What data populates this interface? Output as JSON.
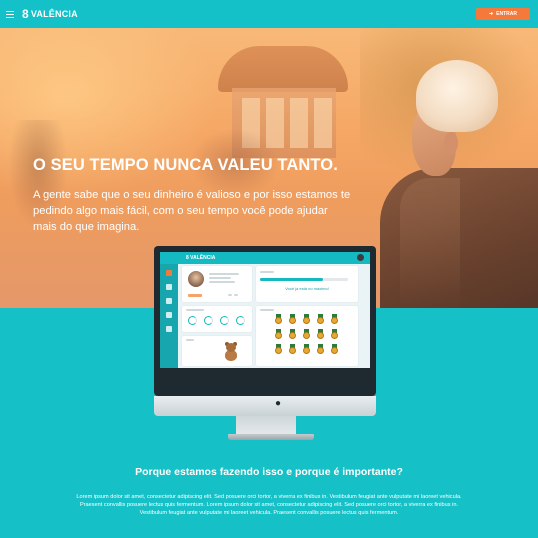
{
  "header": {
    "logo_mark": "8",
    "logo_text": "VALÊNCIA",
    "enter_button": "ENTRAR"
  },
  "hero": {
    "headline": "O SEU TEMPO NUNCA VALEU TANTO.",
    "subtext": "A gente sabe que o seu dinheiro é valioso e por isso estamos te pedindo algo mais fácil, com o seu tempo você pode ajudar mais do que imagina."
  },
  "mockup": {
    "app_logo": "8 VALÊNCIA",
    "level_progress": 0.72,
    "cta_text": "Você já está no máximo!"
  },
  "section": {
    "question": "Porque estamos fazendo isso e porque é importante?",
    "body": "Lorem ipsum dolor sit amet, consectetur adipiscing elit. Sed posuere orci tortor, a viverra ex finibus in. Vestibulum feugiat ante vulputate mi laoreet vehicula. Praesent convallis posuere lectus quis fermentum. Lorem ipsum dolor sit amet, consectetur adipiscing elit. Sed posuere orci tortor, a viverra ex finibus in. Vestibulum feugiat ante vulputate mi laoreet vehicula. Praesent convallis posuere lectus quis fermentum."
  },
  "colors": {
    "teal": "#14c1c8",
    "orange": "#f5793b"
  }
}
